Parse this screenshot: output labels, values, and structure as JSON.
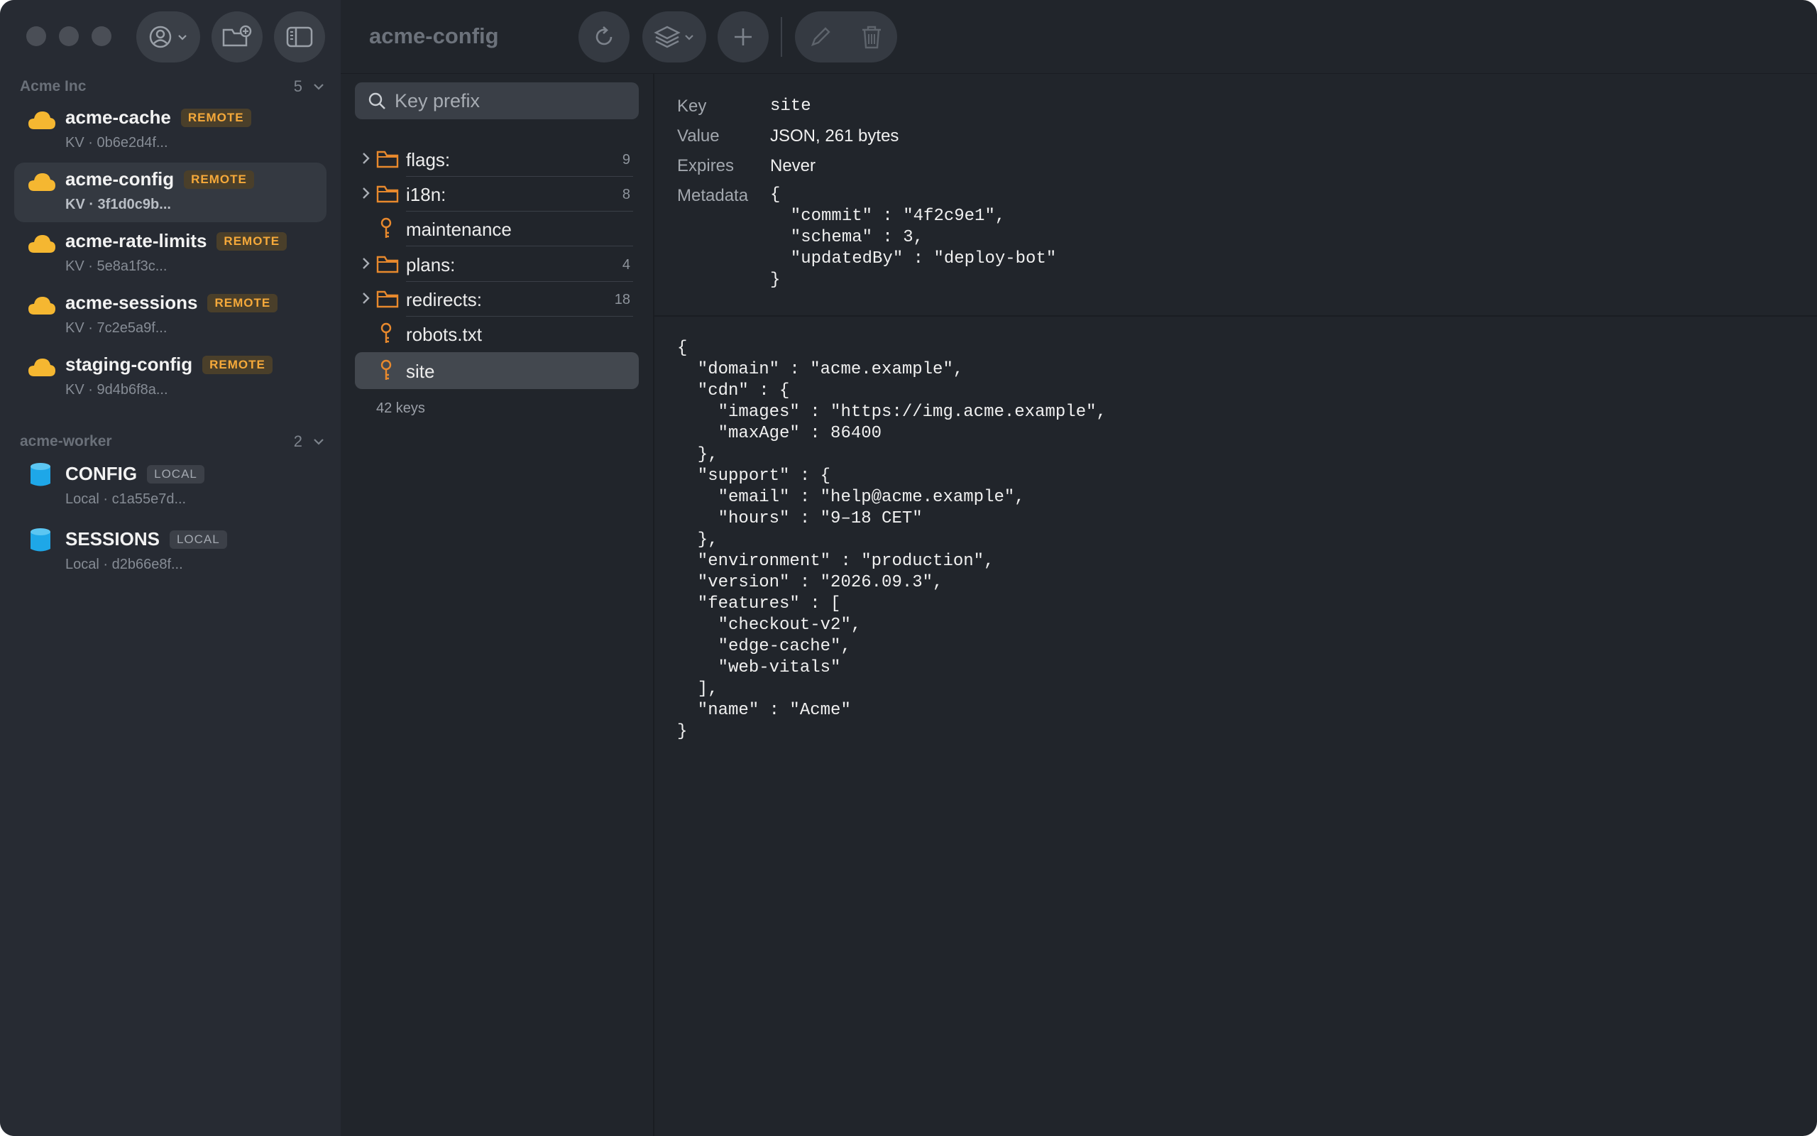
{
  "window": {
    "title": "acme-config"
  },
  "sidebar": {
    "groups": [
      {
        "name": "Acme Inc",
        "count": "5",
        "items": [
          {
            "name": "acme-cache",
            "badge": "REMOTE",
            "sub": "KV · 0b6e2d4f..."
          },
          {
            "name": "acme-config",
            "badge": "REMOTE",
            "sub": "KV · 3f1d0c9b..."
          },
          {
            "name": "acme-rate-limits",
            "badge": "REMOTE",
            "sub": "KV · 5e8a1f3c..."
          },
          {
            "name": "acme-sessions",
            "badge": "REMOTE",
            "sub": "KV · 7c2e5a9f..."
          },
          {
            "name": "staging-config",
            "badge": "REMOTE",
            "sub": "KV · 9d4b6f8a..."
          }
        ]
      },
      {
        "name": "acme-worker",
        "count": "2",
        "items": [
          {
            "name": "CONFIG",
            "badge": "LOCAL",
            "sub": "Local · c1a55e7d..."
          },
          {
            "name": "SESSIONS",
            "badge": "LOCAL",
            "sub": "Local · d2b66e8f..."
          }
        ]
      }
    ],
    "icons": {
      "remote": "cloud-icon",
      "local": "database-icon"
    },
    "colors": {
      "remote_icon": "#f5b731",
      "local_icon": "#1ea7e8",
      "remote_badge": "#f5a93a"
    }
  },
  "toolbar": {
    "icons": [
      "account-icon",
      "new-folder-icon",
      "sidebar-toggle-icon",
      "refresh-icon",
      "layers-icon",
      "add-icon",
      "edit-icon",
      "trash-icon"
    ]
  },
  "keys": {
    "search_placeholder": "Key prefix",
    "items": [
      {
        "label": "flags:",
        "type": "folder",
        "count": "9"
      },
      {
        "label": "i18n:",
        "type": "folder",
        "count": "8"
      },
      {
        "label": "maintenance",
        "type": "key",
        "count": ""
      },
      {
        "label": "plans:",
        "type": "folder",
        "count": "4"
      },
      {
        "label": "redirects:",
        "type": "folder",
        "count": "18"
      },
      {
        "label": "robots.txt",
        "type": "key",
        "count": ""
      },
      {
        "label": "site",
        "type": "key",
        "count": "",
        "selected": true
      }
    ],
    "total": "42 keys",
    "colors": {
      "folder": "#e8892d",
      "key": "#e8892d"
    }
  },
  "detail": {
    "key_label": "Key",
    "key_value": "site",
    "value_label": "Value",
    "value_value": "JSON, 261 bytes",
    "expires_label": "Expires",
    "expires_value": "Never",
    "metadata_label": "Metadata",
    "metadata_json": "{\n  \"commit\" : \"4f2c9e1\",\n  \"schema\" : 3,\n  \"updatedBy\" : \"deploy-bot\"\n}",
    "value_json": "{\n  \"domain\" : \"acme.example\",\n  \"cdn\" : {\n    \"images\" : \"https://img.acme.example\",\n    \"maxAge\" : 86400\n  },\n  \"support\" : {\n    \"email\" : \"help@acme.example\",\n    \"hours\" : \"9–18 CET\"\n  },\n  \"environment\" : \"production\",\n  \"version\" : \"2026.09.3\",\n  \"features\" : [\n    \"checkout-v2\",\n    \"edge-cache\",\n    \"web-vitals\"\n  ],\n  \"name\" : \"Acme\"\n}"
  }
}
